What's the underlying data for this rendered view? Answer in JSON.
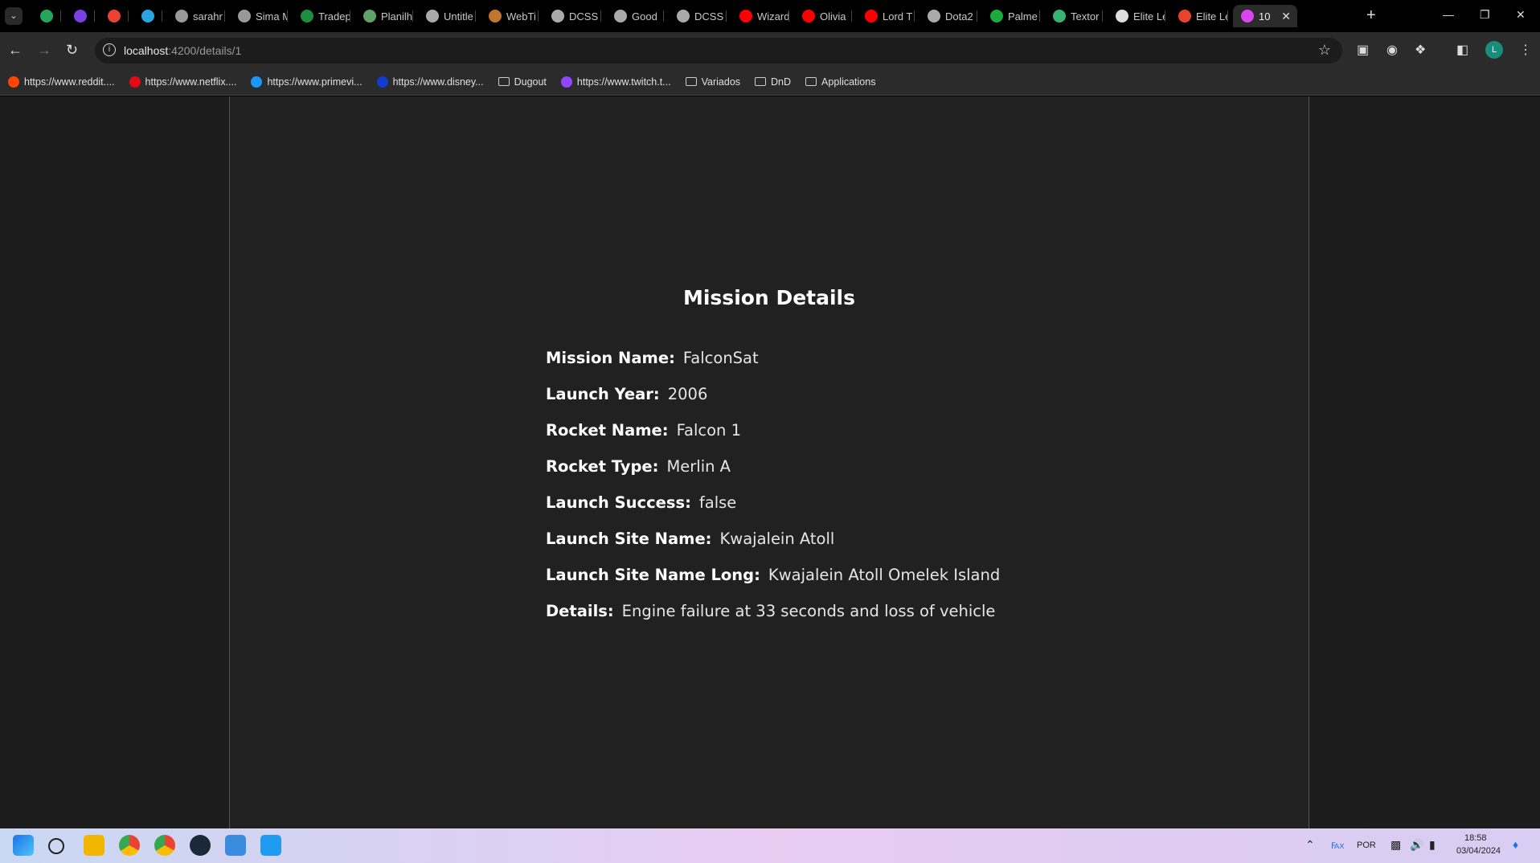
{
  "browser": {
    "tabs": [
      {
        "label": "",
        "color": "#26a65b"
      },
      {
        "label": "",
        "color": "#7b3fe4"
      },
      {
        "label": "",
        "color": "#ea4335"
      },
      {
        "label": "",
        "color": "#2aa3e0"
      },
      {
        "label": "sarahr",
        "color": "#999999"
      },
      {
        "label": "Sima M",
        "color": "#999999"
      },
      {
        "label": "Tradep",
        "color": "#1e8e3e"
      },
      {
        "label": "Planilh",
        "color": "#5fa36b"
      },
      {
        "label": "Untitle",
        "color": "#aaaaaa"
      },
      {
        "label": "WebTi",
        "color": "#c0762e"
      },
      {
        "label": "DCSS",
        "color": "#aaaaaa"
      },
      {
        "label": "Good",
        "color": "#aaaaaa"
      },
      {
        "label": "DCSS",
        "color": "#aaaaaa"
      },
      {
        "label": "Wizard",
        "color": "#ff0000"
      },
      {
        "label": "Olivia",
        "color": "#ff0000"
      },
      {
        "label": "Lord T",
        "color": "#ff0000"
      },
      {
        "label": "Dota2",
        "color": "#aaaaaa"
      },
      {
        "label": "Palme",
        "color": "#1aaa3d"
      },
      {
        "label": "Textor",
        "color": "#3bb273"
      },
      {
        "label": "Elite Le",
        "color": "#dddddd"
      },
      {
        "label": "Elite Le",
        "color": "#e8442c"
      },
      {
        "label": "10",
        "color": "#d946ef",
        "active": true
      }
    ],
    "url_host": "localhost",
    "url_path": ":4200/details/1",
    "bookmarks": [
      {
        "label": "https://www.reddit....",
        "icon": "reddit-icon",
        "color": "#ff4500"
      },
      {
        "label": "https://www.netflix....",
        "icon": "netflix-icon",
        "color": "#e50914"
      },
      {
        "label": "https://www.primevi...",
        "icon": "prime-icon",
        "color": "#1a98ff"
      },
      {
        "label": "https://www.disney...",
        "icon": "disney-icon",
        "color": "#113ccf"
      },
      {
        "label": "Dugout",
        "icon": "folder-icon"
      },
      {
        "label": "https://www.twitch.t...",
        "icon": "twitch-icon",
        "color": "#9146ff"
      },
      {
        "label": "Variados",
        "icon": "folder-icon"
      },
      {
        "label": "DnD",
        "icon": "folder-icon"
      },
      {
        "label": "Applications",
        "icon": "folder-icon"
      }
    ],
    "profile_initial": "L"
  },
  "page": {
    "title": "Mission Details",
    "fields": [
      {
        "label": "Mission Name:",
        "value": "FalconSat"
      },
      {
        "label": "Launch Year:",
        "value": "2006"
      },
      {
        "label": "Rocket Name:",
        "value": "Falcon 1"
      },
      {
        "label": "Rocket Type:",
        "value": "Merlin A"
      },
      {
        "label": "Launch Success:",
        "value": "false"
      },
      {
        "label": "Launch Site Name:",
        "value": "Kwajalein Atoll"
      },
      {
        "label": "Launch Site Name Long:",
        "value": "Kwajalein Atoll Omelek Island"
      },
      {
        "label": "Details:",
        "value": "Engine failure at 33 seconds and loss of vehicle"
      }
    ]
  },
  "taskbar": {
    "language": "POR",
    "time": "18:58",
    "date": "03/04/2024"
  }
}
